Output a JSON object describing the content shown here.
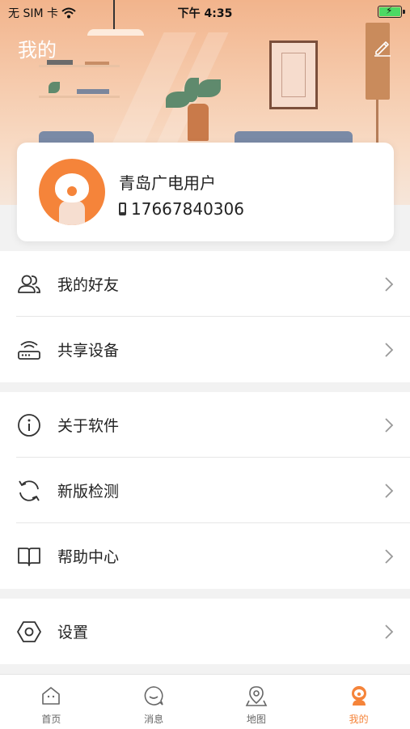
{
  "status_bar": {
    "carrier": "无 SIM 卡",
    "time": "下午 4:35"
  },
  "header": {
    "title": "我的"
  },
  "profile": {
    "name": "青岛广电用户",
    "phone": "17667840306"
  },
  "menu": {
    "friends": "我的好友",
    "shared_devices": "共享设备",
    "about": "关于软件",
    "update_check": "新版检测",
    "help": "帮助中心",
    "settings": "设置"
  },
  "tabbar": {
    "home": "首页",
    "messages": "消息",
    "map": "地图",
    "mine": "我的"
  },
  "colors": {
    "accent": "#f5843a",
    "header_gradient_top": "#f2b48c"
  }
}
